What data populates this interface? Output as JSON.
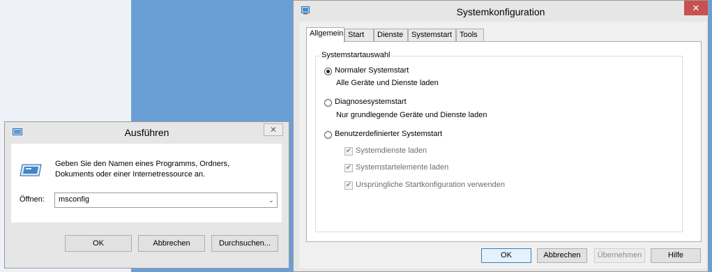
{
  "run_dialog": {
    "title": "Ausführen",
    "close_glyph": "✕",
    "description_line1": "Geben Sie den Namen eines Programms, Ordners,",
    "description_line2": "Dokuments oder einer Internetressource an.",
    "open_label": "Öffnen:",
    "open_value": "msconfig",
    "dropdown_glyph": "⌄",
    "buttons": {
      "ok": "OK",
      "cancel": "Abbrechen",
      "browse": "Durchsuchen..."
    },
    "icon": "run-icon"
  },
  "msconfig": {
    "title": "Systemkonfiguration",
    "close_glyph": "✕",
    "icon": "msconfig-icon",
    "tabs": [
      "Allgemein",
      "Start",
      "Dienste",
      "Systemstart",
      "Tools"
    ],
    "active_tab": "Allgemein",
    "group_label": "Systemstartauswahl",
    "options": [
      {
        "label": "Normaler Systemstart",
        "sub": "Alle Geräte und Dienste laden",
        "selected": true
      },
      {
        "label": "Diagnosesystemstart",
        "sub": "Nur grundlegende Geräte und Dienste laden",
        "selected": false
      },
      {
        "label": "Benutzerdefinierter Systemstart",
        "selected": false
      }
    ],
    "checkboxes": [
      {
        "label": "Systemdienste laden",
        "checked": true,
        "enabled": false
      },
      {
        "label": "Systemstartelemente laden",
        "checked": true,
        "enabled": false
      },
      {
        "label": "Ursprüngliche Startkonfiguration verwenden",
        "checked": true,
        "enabled": false
      }
    ],
    "check_glyph": "✔",
    "buttons": {
      "ok": "OK",
      "cancel": "Abbrechen",
      "apply": "Übernehmen",
      "help": "Hilfe"
    }
  },
  "colors": {
    "desktop_blue": "#6a9fd6",
    "close_red": "#c75050",
    "default_button_border": "#3c7fb1"
  }
}
